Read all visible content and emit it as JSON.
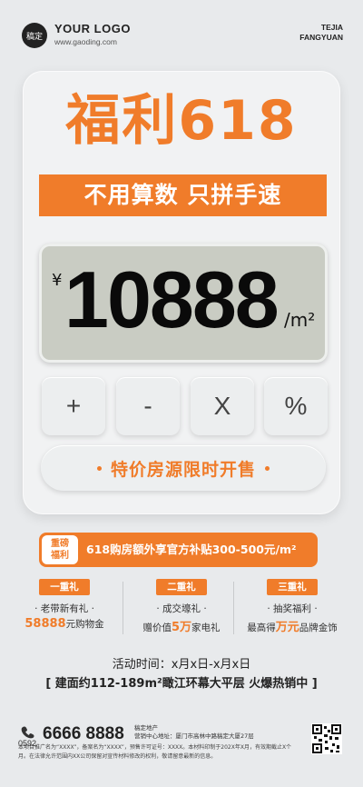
{
  "header": {
    "badge": "稿定",
    "logo": "YOUR LOGO",
    "url": "www.gaoding.com",
    "brand_line1": "TEJIA",
    "brand_line2": "FANGYUAN"
  },
  "hero": {
    "headline": "福利618",
    "subline": "不用算数 只拼手速"
  },
  "calculator": {
    "currency": "¥",
    "price": "10888",
    "unit": "/m²",
    "keys": [
      "+",
      "-",
      "X",
      "%"
    ],
    "sale_button": "特价房源限时开售"
  },
  "subsidy": {
    "tag_line1": "重磅",
    "tag_line2": "福利",
    "text": "618购房额外享官方补贴300-500元/m²"
  },
  "gifts": [
    {
      "title": "一重礼",
      "line1": "· 老带新有礼 ·",
      "highlight": "58888",
      "suffix": "元购物金",
      "prefix": ""
    },
    {
      "title": "二重礼",
      "line1": "· 成交壕礼 ·",
      "prefix": "赠价值",
      "highlight": "5万",
      "suffix": "家电礼"
    },
    {
      "title": "三重礼",
      "line1": "· 抽奖福利 ·",
      "prefix": "最高得",
      "highlight": "万元",
      "suffix": "品牌金饰"
    }
  ],
  "activity": "活动时间：x月x日-x月x日",
  "area": "[  建面约112-189m²瞰江环幕大平层 火爆热销中  ]",
  "footer": {
    "area_code": "0592",
    "phone": "6666 8888",
    "developer_line1": "稿定地产",
    "developer_line2": "营销中心地址：厦门市高林中路稿定大厦27层",
    "fine_print": "本项目推广名为“XXXX”，备案名为“XXXX”，预售许可证号：XXXX。本材料印制于202X年X月，有效期截止X个月。在法律允许范围内XX公司保留对宣传材料修改的权利，敬请留意最新的信息。"
  },
  "colors": {
    "accent": "#f07c2a",
    "background": "#e8eaec",
    "screen": "#c9ccc3"
  }
}
